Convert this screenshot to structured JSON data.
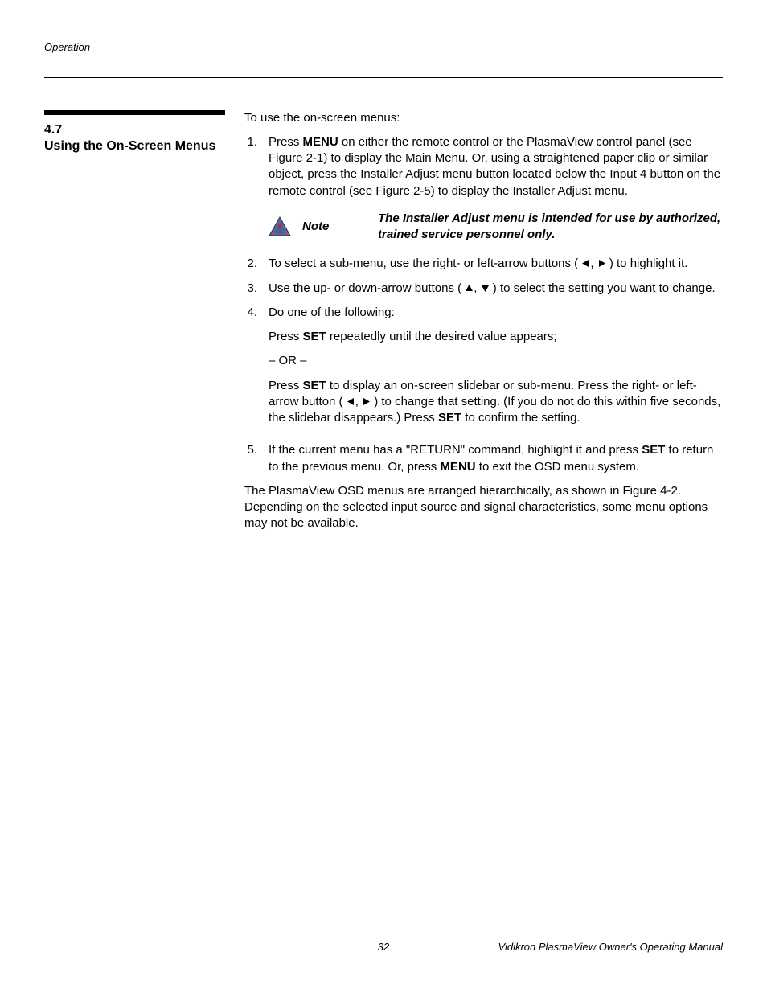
{
  "header": {
    "running": "Operation"
  },
  "section": {
    "number": "4.7",
    "title": "Using the On-Screen Menus"
  },
  "intro": "To use the on-screen menus:",
  "steps": {
    "s1": {
      "num": "1.",
      "pre": "Press ",
      "b1": "MENU",
      "post": " on either the remote control or the PlasmaView control panel (see Figure 2-1) to display the Main Menu. Or, using a straightened paper clip or similar object, press the Installer Adjust menu button located below the Input 4 button on the remote control (see Figure 2-5) to display the Installer Adjust menu."
    },
    "note": {
      "label": "Note",
      "text": "The Installer Adjust menu is intended for use by authorized, trained service personnel only."
    },
    "s2": {
      "num": "2.",
      "pre": "To select a sub-menu, use the right- or left-arrow buttons ( ",
      "sep": ", ",
      "post": " ) to highlight it."
    },
    "s3": {
      "num": "3.",
      "pre": "Use the up- or down-arrow buttons ( ",
      "sep": ", ",
      "post": " ) to select the setting you want to change."
    },
    "s4": {
      "num": "4.",
      "text": "Do one of the following:",
      "p1a": "Press ",
      "p1b": "SET",
      "p1c": " repeatedly until the desired value appears;",
      "or": "– OR –",
      "p2a": "Press ",
      "p2b": "SET",
      "p2c": " to display an on-screen slidebar or sub-menu. Press the right- or left-arrow button ( ",
      "p2sep": ", ",
      "p2d": " ) to change that setting. (If you do not do this within five seconds, the slidebar disappears.) Press ",
      "p2e": "SET",
      "p2f": " to confirm the setting."
    },
    "s5": {
      "num": "5.",
      "pre": "If the current menu has a \"RETURN\" command, highlight it and press ",
      "b1": "SET",
      "mid": " to return to the previous menu. Or, press ",
      "b2": "MENU",
      "post": " to exit the OSD menu system."
    }
  },
  "closing": "The PlasmaView OSD menus are arranged hierarchically, as shown in Figure 4-2. Depending on the selected input source and signal characteristics, some menu options may not be available.",
  "footer": {
    "page": "32",
    "manual": "Vidikron PlasmaView Owner's Operating Manual"
  }
}
